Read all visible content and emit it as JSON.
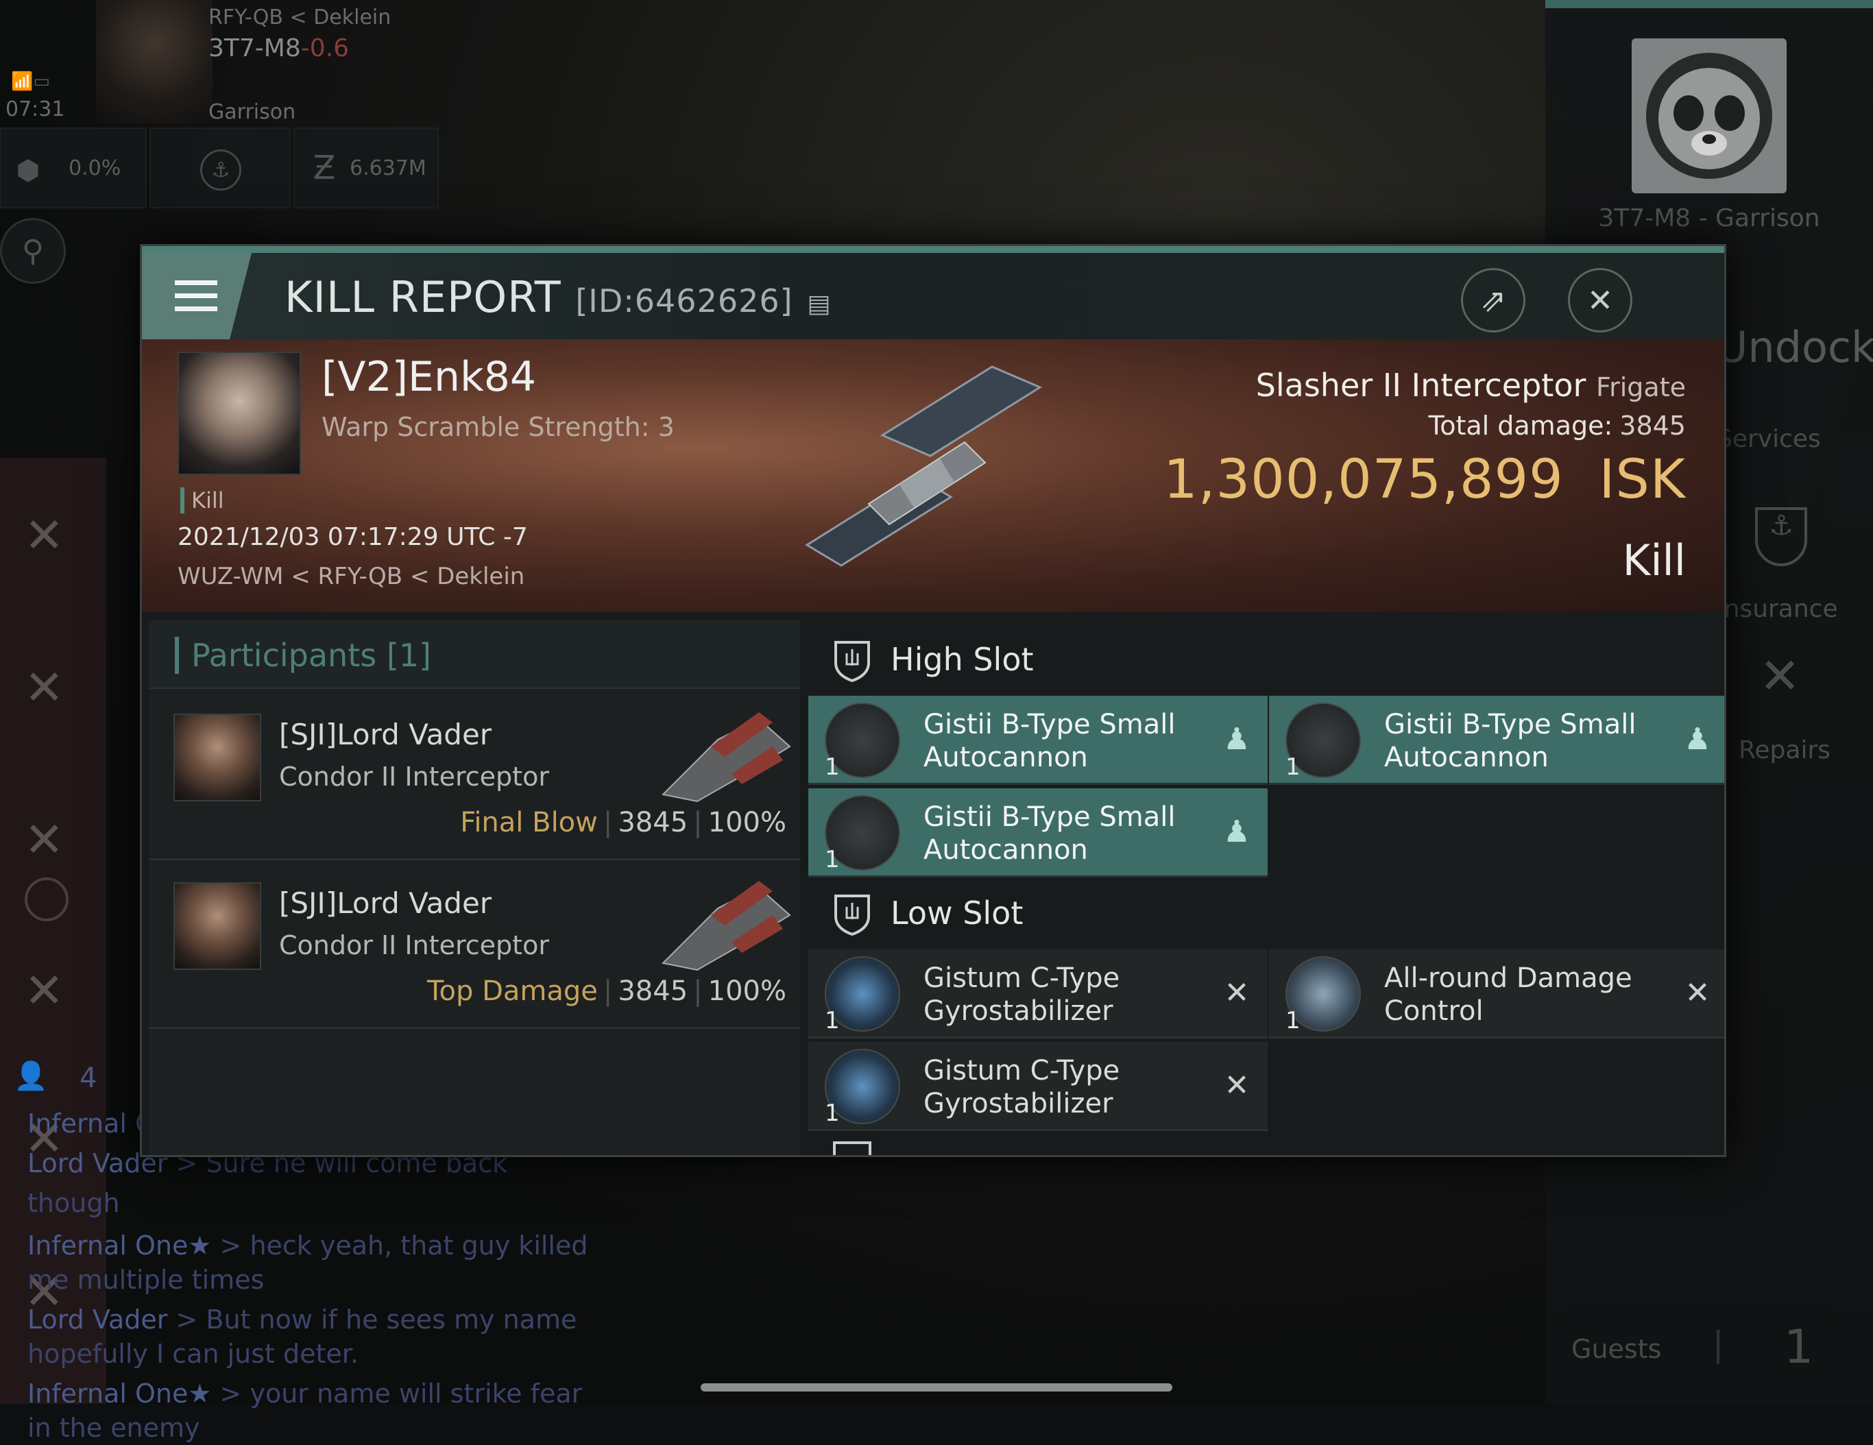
{
  "hud": {
    "location_path": "RFY-QB < Deklein",
    "system": "3T7-M8",
    "security": "-0.6",
    "time": "07:31",
    "structure": "Garrison",
    "cargo_percent": "0.0%",
    "wallet": "6.637M"
  },
  "station": {
    "name": "3T7-M8 - Garrison",
    "undock_label": "Undock",
    "services_label": "Services",
    "insurance_label": "Insurance",
    "repairs_label": "Repairs",
    "guests_label": "Guests",
    "guests_count": "1"
  },
  "chat": {
    "count": "4",
    "lines": [
      {
        "name": "Infernal O",
        "msg": ""
      },
      {
        "name": "Lord Vader",
        "msg": " > Sure he will come back though"
      },
      {
        "name": "Infernal One★",
        "msg": " > heck yeah, that guy killed me multiple times"
      },
      {
        "name": "Lord Vader",
        "msg": " > But now if he sees my name hopefully I can just deter."
      },
      {
        "name": "Infernal One★",
        "msg": " > your name will strike fear in the enemy"
      }
    ]
  },
  "report": {
    "title": "KILL REPORT",
    "id": "[ID:6462626]",
    "victim": {
      "name": "[V2]Enk84",
      "subtitle": "Warp Scramble Strength: 3",
      "tag": "Kill",
      "datetime": "2021/12/03 07:17:29 UTC -7",
      "location": "WUZ-WM < RFY-QB < Deklein"
    },
    "ship": {
      "name": "Slasher II Interceptor",
      "class": "Frigate",
      "total_damage_label": "Total damage:",
      "total_damage": "3845",
      "isk": "1,300,075,899",
      "isk_unit": "ISK",
      "result": "Kill"
    }
  },
  "participants": {
    "header": "Participants [1]",
    "rows": [
      {
        "name": "[SJI]Lord Vader",
        "ship": "Condor II Interceptor",
        "role": "Final Blow",
        "damage": "3845",
        "percent": "100%"
      },
      {
        "name": "[SJI]Lord Vader",
        "ship": "Condor II Interceptor",
        "role": "Top Damage",
        "damage": "3845",
        "percent": "100%"
      }
    ]
  },
  "slots": {
    "high": {
      "label": "High Slot",
      "items": [
        {
          "qty": "1",
          "name": "Gistii B-Type Small Autocannon"
        },
        {
          "qty": "1",
          "name": "Gistii B-Type Small Autocannon"
        },
        {
          "qty": "1",
          "name": "Gistii B-Type Small Autocannon"
        }
      ]
    },
    "low": {
      "label": "Low Slot",
      "items": [
        {
          "qty": "1",
          "name": "Gistum C-Type Gyrostabilizer"
        },
        {
          "qty": "1",
          "name": "All-round Damage Control"
        },
        {
          "qty": "1",
          "name": "Gistum C-Type Gyrostabilizer"
        }
      ]
    }
  },
  "colors": {
    "accent": "#4f7e75",
    "isk": "#e7bd72",
    "gold": "#c6a35c",
    "active_item": "#3e6d68"
  }
}
